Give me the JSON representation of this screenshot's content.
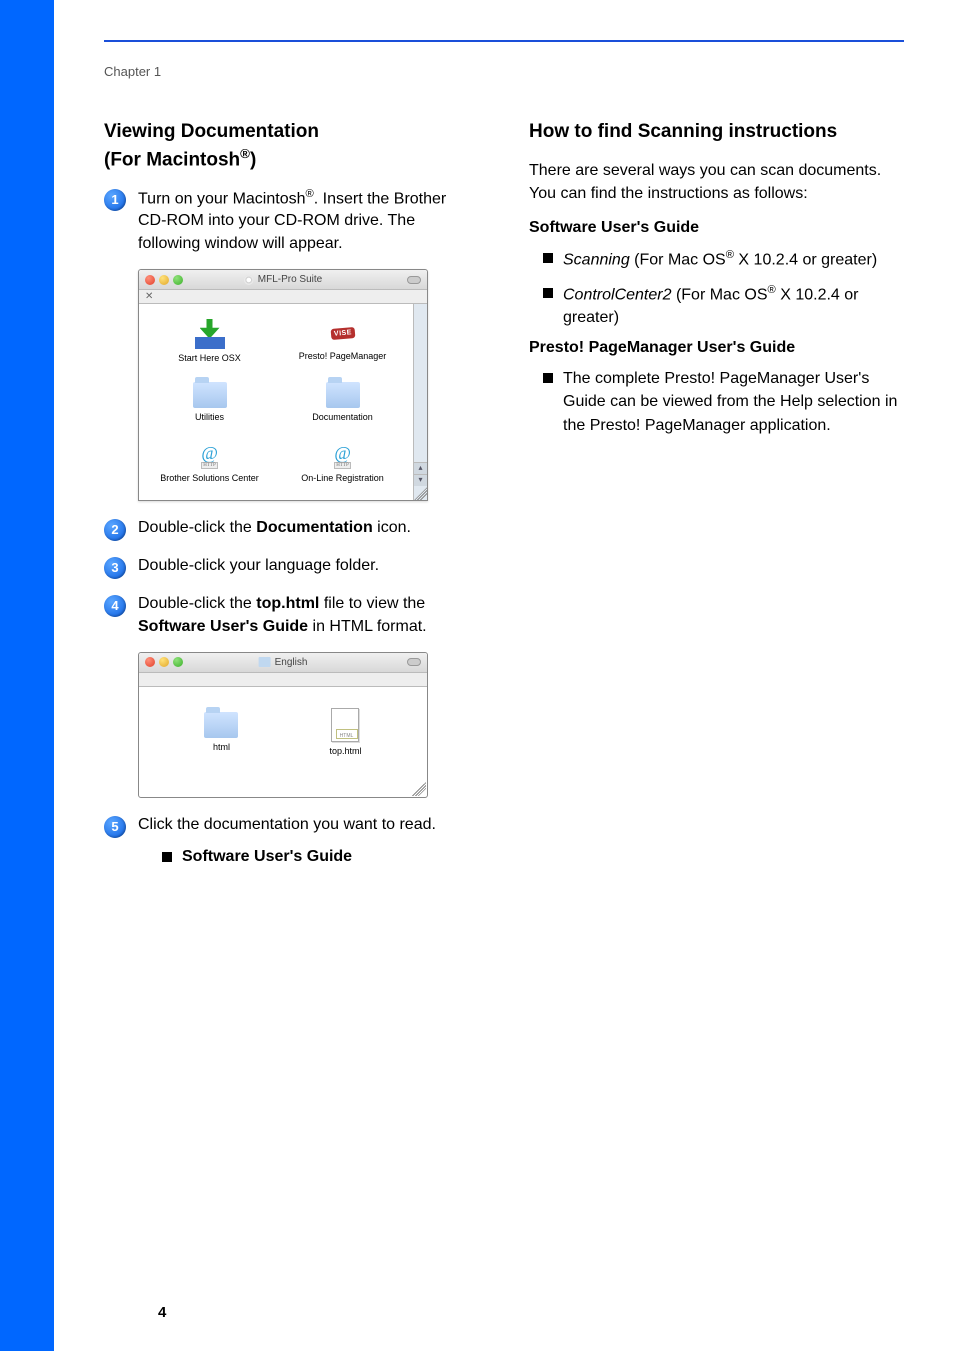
{
  "chapter": "Chapter 1",
  "pageNumber": "4",
  "left": {
    "heading_line1": "Viewing Documentation",
    "heading_line2_pre": "(For Macintosh",
    "heading_line2_post": ")",
    "reg": "®",
    "steps": {
      "s1_pre": "Turn on your Macintosh",
      "s1_post": ". Insert the Brother CD-ROM into your CD-ROM drive. The following window will appear.",
      "s2_pre": "Double-click the ",
      "s2_bold": "Documentation",
      "s2_post": " icon.",
      "s3": "Double-click your language folder.",
      "s4_pre": "Double-click the ",
      "s4_bold1": "top.html",
      "s4_mid": " file to view the ",
      "s4_bold2": "Software User's Guide",
      "s4_post": " in HTML format.",
      "s5": "Click the documentation you want to read.",
      "s5_sub": "Software User's Guide"
    },
    "fig1": {
      "title": "MFL-Pro Suite",
      "items": [
        "Start Here OSX",
        "Presto! PageManager",
        "Utilities",
        "Documentation",
        "Brother Solutions Center",
        "On-Line Registration"
      ],
      "vise": "VISE",
      "http": "HTTP"
    },
    "fig2": {
      "title": "English",
      "folder": "html",
      "file": "top.html",
      "htmlLabel": "HTML"
    }
  },
  "right": {
    "heading": "How to find Scanning instructions",
    "intro": "There are several ways you can scan documents. You can find the instructions as follows:",
    "sub1": "Software User's Guide",
    "li1_it": "Scanning",
    "li1_rest_pre": " (For Mac OS",
    "li1_rest_post": " X 10.2.4 or greater)",
    "li2_it": "ControlCenter2",
    "li2_rest_pre": " (For Mac OS",
    "li2_rest_post": " X 10.2.4 or greater)",
    "sub2": "Presto! PageManager User's Guide",
    "li3": "The complete Presto! PageManager User's Guide can be viewed from the Help selection in the Presto! PageManager application."
  }
}
